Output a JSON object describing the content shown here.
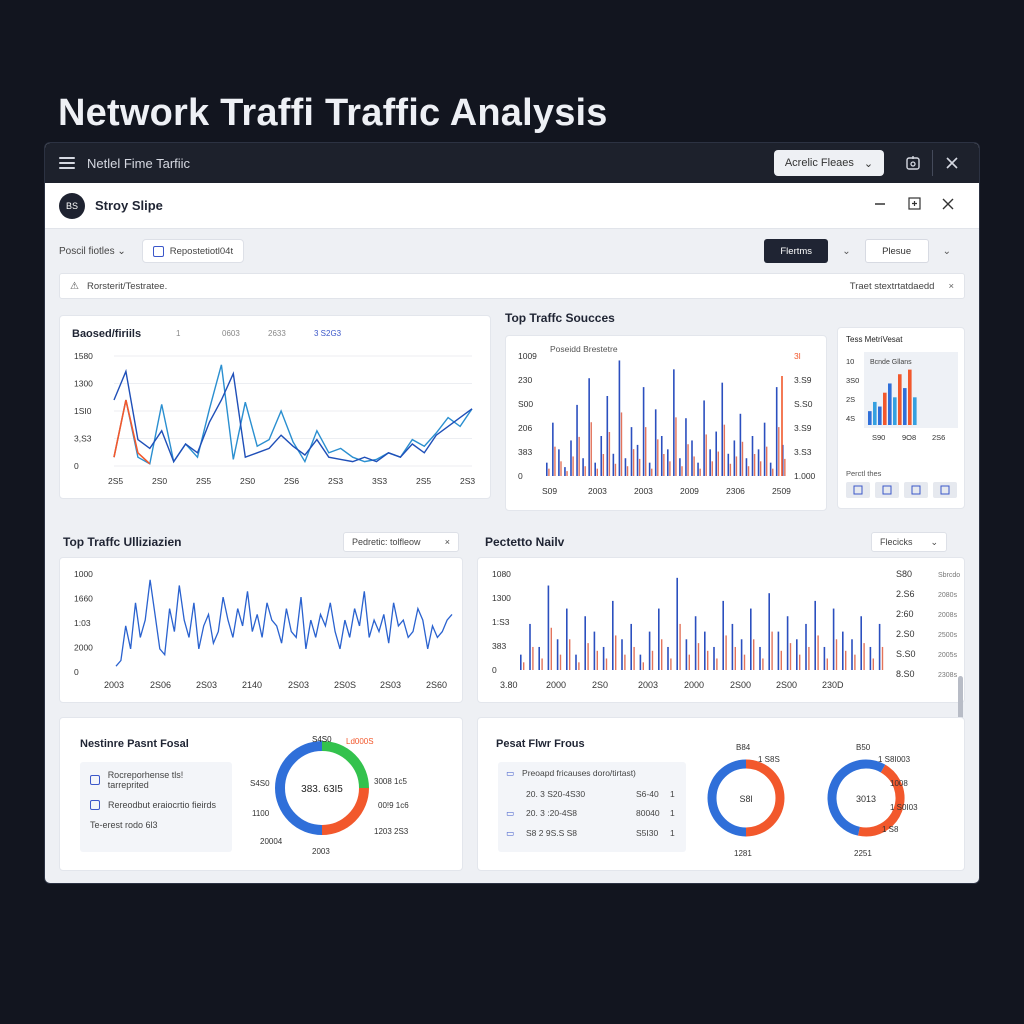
{
  "headline": "Network Traffi Traffic Analysis",
  "titlebar": {
    "title": "Netlel Fime Tarfiic",
    "select_label": "Acrelic Fleaes",
    "select_chevron": "⌄"
  },
  "appbar": {
    "logo_text": "BS",
    "name": "Stroy Slipe"
  },
  "filterbar": {
    "label": "Poscil fiotles ⌄",
    "chip": "Repostetiotl04t",
    "primary_button": "Flertms",
    "secondary_button": "Plesue"
  },
  "alert": {
    "text": "Rorsterit/Testratee.",
    "right_text": "Traet stextrtatdaedd",
    "close": "×"
  },
  "bandwidth": {
    "title": "Baosed/firiils",
    "meta": [
      "1",
      "0603",
      "2633",
      "3 S2G3"
    ],
    "y_ticks": [
      "1580",
      "1300",
      "1SI0",
      "3,S3",
      "0"
    ],
    "x_ticks": [
      "2S5",
      "2S0",
      "2S5",
      "2S0",
      "2S6",
      "2S3",
      "3S3",
      "2S5",
      "2S3"
    ]
  },
  "sources": {
    "title": "Top Traffc Soucces",
    "inner_title": "Poseidd Brestetre",
    "y_ticks": [
      "1009",
      "230",
      "S00",
      "206",
      "383",
      "0"
    ],
    "y2_ticks": [
      "3l",
      "3.S9",
      "S.S0",
      "3.S9",
      "3.S3",
      "1.000"
    ],
    "x_ticks": [
      "S09",
      "2003",
      "2003",
      "2009",
      "2306",
      "2509"
    ]
  },
  "mini": {
    "title": "Tess MetriVesat",
    "inner_title": "Bcnde Gllans",
    "y_ticks": [
      "10",
      "3S0",
      "2S",
      "4S"
    ],
    "x_ticks": [
      "S90",
      "9O8",
      "2S6"
    ],
    "footer": "Perctl thes",
    "icons": [
      "filter-icon",
      "grid-icon",
      "screen-icon",
      "share-icon"
    ]
  },
  "utilization": {
    "title": "Top Traffc Ulliziazien",
    "dropdown": "Pedretic: tolfleow",
    "dropdown_icon": "×",
    "y_ticks": [
      "1000",
      "1660",
      "1:03",
      "2000",
      "0"
    ],
    "x_ticks": [
      "2003",
      "2S06",
      "2S03",
      "2140",
      "2S03",
      "2S0S",
      "2S03",
      "2S60"
    ]
  },
  "protocol": {
    "title": "Pectetto Nailv",
    "dropdown": "Flecicks",
    "dropdown_icon": "⌄",
    "y_ticks": [
      "1080",
      "1300",
      "1:S3",
      "383",
      "0"
    ],
    "y2_ticks": [
      "S80",
      "2.S6",
      "2:60",
      "2.S0",
      "S.S0",
      "8.S0"
    ],
    "y3_ticks": [
      "Sbrcdo",
      "2080s",
      "2008s",
      "2500s",
      "2005s",
      "2308s"
    ],
    "x_ticks": [
      "3.80",
      "2000",
      "2S0",
      "2003",
      "2000",
      "2S00",
      "2S00",
      "230D"
    ]
  },
  "nodes": {
    "title": "Nestinre Pasnt Fosal",
    "list": [
      "Rocreporhense tls! tarreprited",
      "Rereodbut eraiocrtio fieirds",
      "Te-erest rodo 6l3"
    ],
    "donut_center": "383. 63I5",
    "labels": [
      "S4S0",
      "Ld000S",
      "S4S0",
      "3008 1c5",
      "1100",
      "00!9 1c6",
      "20004",
      "1203 2S3",
      "2003"
    ]
  },
  "flows": {
    "title": "Pesat Flwr Frous",
    "header": "Preoapd fricauses doro/tirtast)",
    "rows": [
      {
        "a": "20. 3 S20-4S30",
        "b": "S6-40",
        "c": "1"
      },
      {
        "a": "20. 3 :20-4S8",
        "b": "80040",
        "c": "1"
      },
      {
        "a": "S8 2 9S.S S8",
        "b": "S5I30",
        "c": "1"
      }
    ],
    "donut1": {
      "center": "S8l",
      "top": "B84",
      "label1": "1 S8S",
      "bottom": "1281"
    },
    "donut2": {
      "center": "3013",
      "top": "B50",
      "label1": "1 S8I003",
      "label2": "1008",
      "label3": "1 S0I03",
      "label4": "1 S8",
      "bottom": "2251"
    }
  },
  "colors": {
    "blue": "#2f6fd9",
    "orange": "#f2582c",
    "green": "#33c24d",
    "navy": "#1f2433"
  },
  "chart_data": [
    {
      "type": "line",
      "title": "Baosed/firiils",
      "x": [
        0,
        1,
        2,
        3,
        4,
        5,
        6,
        7,
        8,
        9,
        10,
        11,
        12,
        13,
        14,
        15,
        16,
        17,
        18,
        19,
        20,
        21,
        22,
        23,
        24,
        25,
        26,
        27,
        28,
        29,
        30
      ],
      "series": [
        {
          "values": [
            40,
            300,
            40,
            10,
            280,
            20,
            100,
            40,
            260,
            460,
            30,
            290,
            90,
            120,
            250,
            110,
            20,
            160,
            60,
            80,
            40,
            20,
            30,
            60,
            40,
            120,
            90,
            150,
            220,
            180,
            260
          ]
        },
        {
          "values": [
            300,
            430,
            120,
            80,
            160,
            20,
            100,
            60,
            200,
            300,
            420,
            40,
            60,
            80,
            140,
            90,
            50,
            120,
            40,
            30,
            20,
            40,
            20,
            60,
            40,
            100,
            60,
            140,
            180,
            220,
            260
          ]
        }
      ],
      "ylim": [
        0,
        500
      ]
    },
    {
      "type": "bar",
      "title": "Top Traffc Soucces",
      "values": [
        30,
        120,
        60,
        20,
        80,
        160,
        40,
        220,
        30,
        90,
        180,
        50,
        260,
        40,
        110,
        70,
        200,
        30,
        150,
        90,
        60,
        240,
        40,
        130,
        80,
        30,
        170,
        60,
        100,
        210,
        50,
        80,
        140,
        40,
        90,
        60,
        120,
        30,
        200,
        70
      ]
    },
    {
      "type": "bar",
      "title": "Tess MetriVesat",
      "categories": [
        "S90",
        "9O8",
        "2S6"
      ],
      "values": [
        30,
        50,
        40,
        70,
        90,
        60,
        110,
        80,
        120,
        60
      ]
    },
    {
      "type": "line",
      "title": "Top Traffc Ulliziazien",
      "values": [
        10,
        20,
        80,
        40,
        120,
        60,
        90,
        160,
        100,
        40,
        30,
        110,
        70,
        150,
        90,
        60,
        120,
        40,
        80,
        100,
        50,
        70,
        130,
        90,
        60,
        110,
        80,
        140,
        70,
        100,
        60,
        120,
        90,
        80,
        50,
        110,
        70,
        60,
        130,
        40,
        90,
        60,
        100,
        80,
        120,
        70,
        40,
        90,
        60,
        110,
        80,
        140,
        60,
        90,
        70,
        100,
        50,
        120,
        80,
        90,
        60,
        70,
        110,
        90,
        40,
        80,
        60,
        70,
        90,
        100
      ]
    },
    {
      "type": "bar",
      "title": "Pectetto Nailv",
      "values": [
        20,
        60,
        30,
        110,
        40,
        80,
        20,
        70,
        50,
        30,
        90,
        40,
        60,
        20,
        50,
        80,
        30,
        120,
        40,
        70,
        50,
        30,
        90,
        60,
        40,
        80,
        30,
        100,
        50,
        70,
        40,
        60,
        90,
        30,
        80,
        50,
        40,
        70,
        30,
        60
      ]
    },
    {
      "type": "pie",
      "title": "Nestinre Pasnt Fosal",
      "values": [
        25,
        25,
        50
      ],
      "colors": [
        "#33c24d",
        "#f2582c",
        "#2f6fd9"
      ]
    },
    {
      "type": "pie",
      "title": "Pesat Flwr Frous",
      "values": [
        50,
        50
      ],
      "colors": [
        "#f2582c",
        "#2f6fd9"
      ]
    },
    {
      "type": "pie",
      "title": "Pesat Flwr Frous",
      "values": [
        45,
        55
      ],
      "colors": [
        "#f2582c",
        "#2f6fd9"
      ]
    }
  ]
}
